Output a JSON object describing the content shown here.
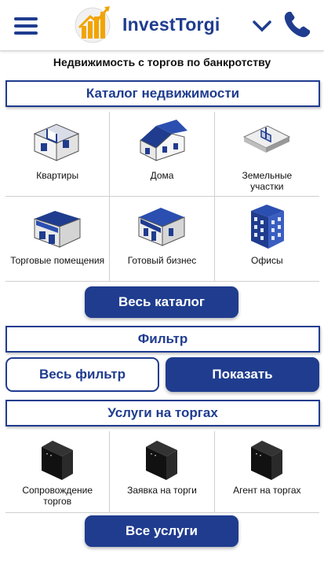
{
  "header": {
    "brand": "InvestTorgi",
    "menu_icon": "hamburger-menu-icon",
    "logo_icon": "bar-chart-arrow-logo",
    "expand_icon": "chevron-down-icon",
    "phone_icon": "phone-icon",
    "accent": "#1f3c8f"
  },
  "subtitle": "Недвижимость с торгов по банкротству",
  "catalog": {
    "title": "Каталог недвижимости",
    "items": [
      {
        "label": "Квартиры",
        "icon": "apartment-icon"
      },
      {
        "label": "Дома",
        "icon": "house-icon"
      },
      {
        "label": "Земельные\nучастки",
        "icon": "land-plot-icon"
      },
      {
        "label": "Торговые помещения",
        "icon": "shop-icon"
      },
      {
        "label": "Готовый бизнес",
        "icon": "cafe-business-icon"
      },
      {
        "label": "Офисы",
        "icon": "office-building-icon"
      }
    ],
    "all_button": "Весь каталог"
  },
  "filter": {
    "title": "Фильтр",
    "all_button": "Весь фильтр",
    "show_button": "Показать"
  },
  "services": {
    "title": "Услуги на торгах",
    "items": [
      {
        "label": "Сопровождение\nторгов",
        "icon": "black-box-icon"
      },
      {
        "label": "Заявка на торги",
        "icon": "black-box-icon"
      },
      {
        "label": "Агент на торгах",
        "icon": "black-box-icon"
      }
    ],
    "all_button": "Все услуги"
  }
}
